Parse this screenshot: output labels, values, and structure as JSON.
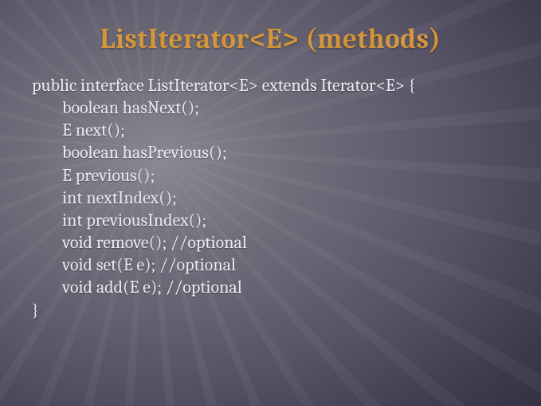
{
  "title": "ListIterator<E> (methods)",
  "code": {
    "declaration": "public interface ListIterator<E> extends Iterator<E> {",
    "lines": [
      "boolean hasNext();",
      "E next();",
      "boolean hasPrevious();",
      "E previous();",
      "int nextIndex();",
      "int previousIndex();",
      "void remove(); //optional",
      "void set(E e); //optional",
      "void add(E e); //optional"
    ],
    "close": "}"
  }
}
